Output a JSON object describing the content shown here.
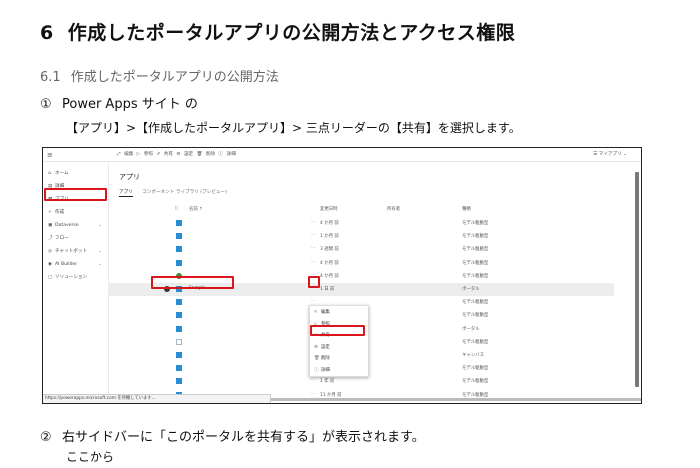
{
  "heading": {
    "number": "6",
    "text": "作成したポータルアプリの公開方法とアクセス権限"
  },
  "section": {
    "number": "6.1",
    "text": "作成したポータルアプリの公開方法"
  },
  "steps": [
    {
      "mark": "①",
      "text": "Power Apps サイト の",
      "sub": "【アプリ】>【作成したポータルアプリ】> 三点リーダーの【共有】を選択します。"
    },
    {
      "mark": "②",
      "text": "右サイドバーに「このポータルを共有する」が表示されます。",
      "sub": "ここから"
    }
  ],
  "screenshot": {
    "topbar": {
      "menu_icon": "hamburger-icon",
      "commands": "⤢ 編集  ▷ 参照  ⇗ 共有  ⚙ 設定  🗑 削除  ⓘ 詳細",
      "my_apps": "☰ マイアプリ ⌄"
    },
    "nav": [
      {
        "icon": "⌂",
        "label": "ホーム"
      },
      {
        "icon": "▤",
        "label": "詳細"
      },
      {
        "icon": "▦",
        "label": "アプリ"
      },
      {
        "icon": "+",
        "label": "作成"
      },
      {
        "icon": "▣",
        "label": "Dataverse",
        "chevron": "⌄"
      },
      {
        "icon": "⤴",
        "label": "フロー"
      },
      {
        "icon": "◎",
        "label": "チャットボット",
        "chevron": "⌄"
      },
      {
        "icon": "◉",
        "label": "AI Builder",
        "chevron": "⌄"
      },
      {
        "icon": "▢",
        "label": "ソリューション"
      }
    ],
    "title": "アプリ",
    "tabs": [
      "アプリ",
      "コンポーネント ライブラリ (プレビュー)"
    ],
    "columns": {
      "name": "名前 ↑",
      "modified": "変更日時",
      "owner": "所有者",
      "type": "種類"
    },
    "rows": [
      {
        "name": "",
        "modified": "4 か月 前",
        "type": "モデル駆動型",
        "icon": "app"
      },
      {
        "name": "",
        "modified": "1 か月 前",
        "type": "モデル駆動型",
        "icon": "app"
      },
      {
        "name": "",
        "modified": "3 週間 前",
        "type": "モデル駆動型",
        "icon": "app"
      },
      {
        "name": "",
        "modified": "4 か月 前",
        "type": "モデル駆動型",
        "icon": "app"
      },
      {
        "name": "",
        "modified": "4 か月 前",
        "type": "モデル駆動型",
        "icon": "green"
      },
      {
        "name": "Sample",
        "modified": "1 日 前",
        "type": "ポータル",
        "icon": "app",
        "selected": true
      },
      {
        "name": "",
        "modified": "",
        "type": "モデル駆動型",
        "icon": "app"
      },
      {
        "name": "",
        "modified": "",
        "type": "モデル駆動型",
        "icon": "app"
      },
      {
        "name": "",
        "modified": "",
        "type": "ポータル",
        "icon": "app"
      },
      {
        "name": "",
        "modified": "",
        "type": "モデル駆動型",
        "icon": "doc"
      },
      {
        "name": "",
        "modified": "",
        "type": "キャンバス",
        "icon": "app"
      },
      {
        "name": "",
        "modified": "4 か月 前",
        "type": "モデル駆動型",
        "icon": "app"
      },
      {
        "name": "",
        "modified": "1 年 前",
        "type": "モデル駆動型",
        "icon": "app"
      },
      {
        "name": "",
        "modified": "11 か月 前",
        "type": "モデル駆動型",
        "icon": "app"
      }
    ],
    "context_menu": [
      {
        "icon": "✎",
        "label": "編集"
      },
      {
        "icon": "▷",
        "label": "参照"
      },
      {
        "icon": "⇗",
        "label": "共有"
      },
      {
        "icon": "⚙",
        "label": "設定"
      },
      {
        "icon": "🗑",
        "label": "削除"
      },
      {
        "icon": "ⓘ",
        "label": "詳細"
      }
    ],
    "status_url": "https://powerapps.microsoft.com を待機しています..."
  }
}
